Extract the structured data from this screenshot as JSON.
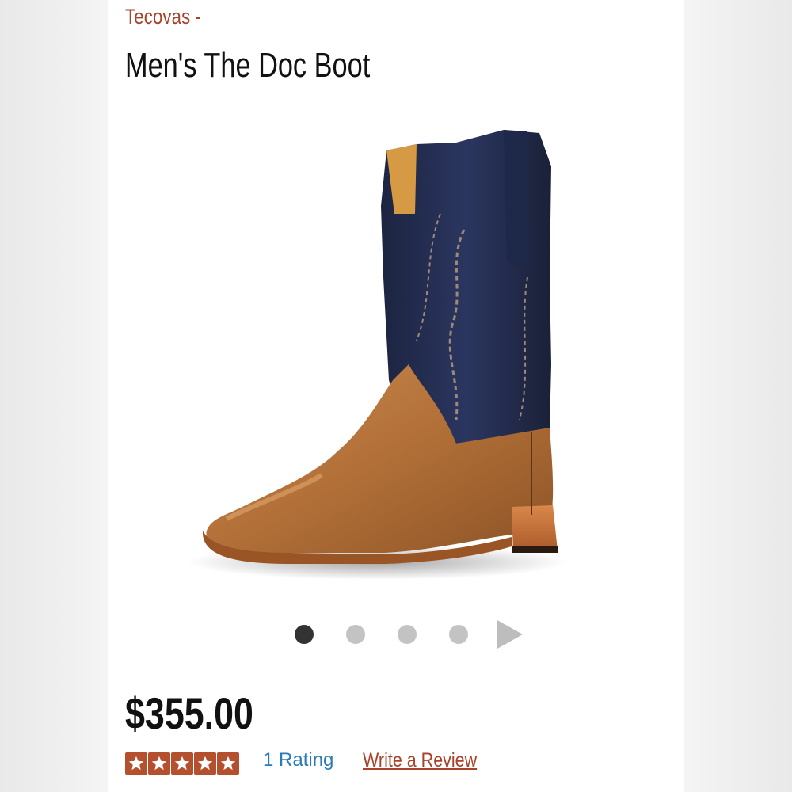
{
  "product": {
    "brand": "Tecovas -",
    "name": "Men's The Doc Boot",
    "price": "$355.00"
  },
  "carousel": {
    "total_dots": 4,
    "active_index": 0
  },
  "rating": {
    "stars": 5,
    "count_label": "1 Rating",
    "write_review_label": "Write a Review"
  },
  "colors": {
    "brand": "#a7432a",
    "star_bg": "#b5502f",
    "link_blue": "#2a7bb8"
  }
}
